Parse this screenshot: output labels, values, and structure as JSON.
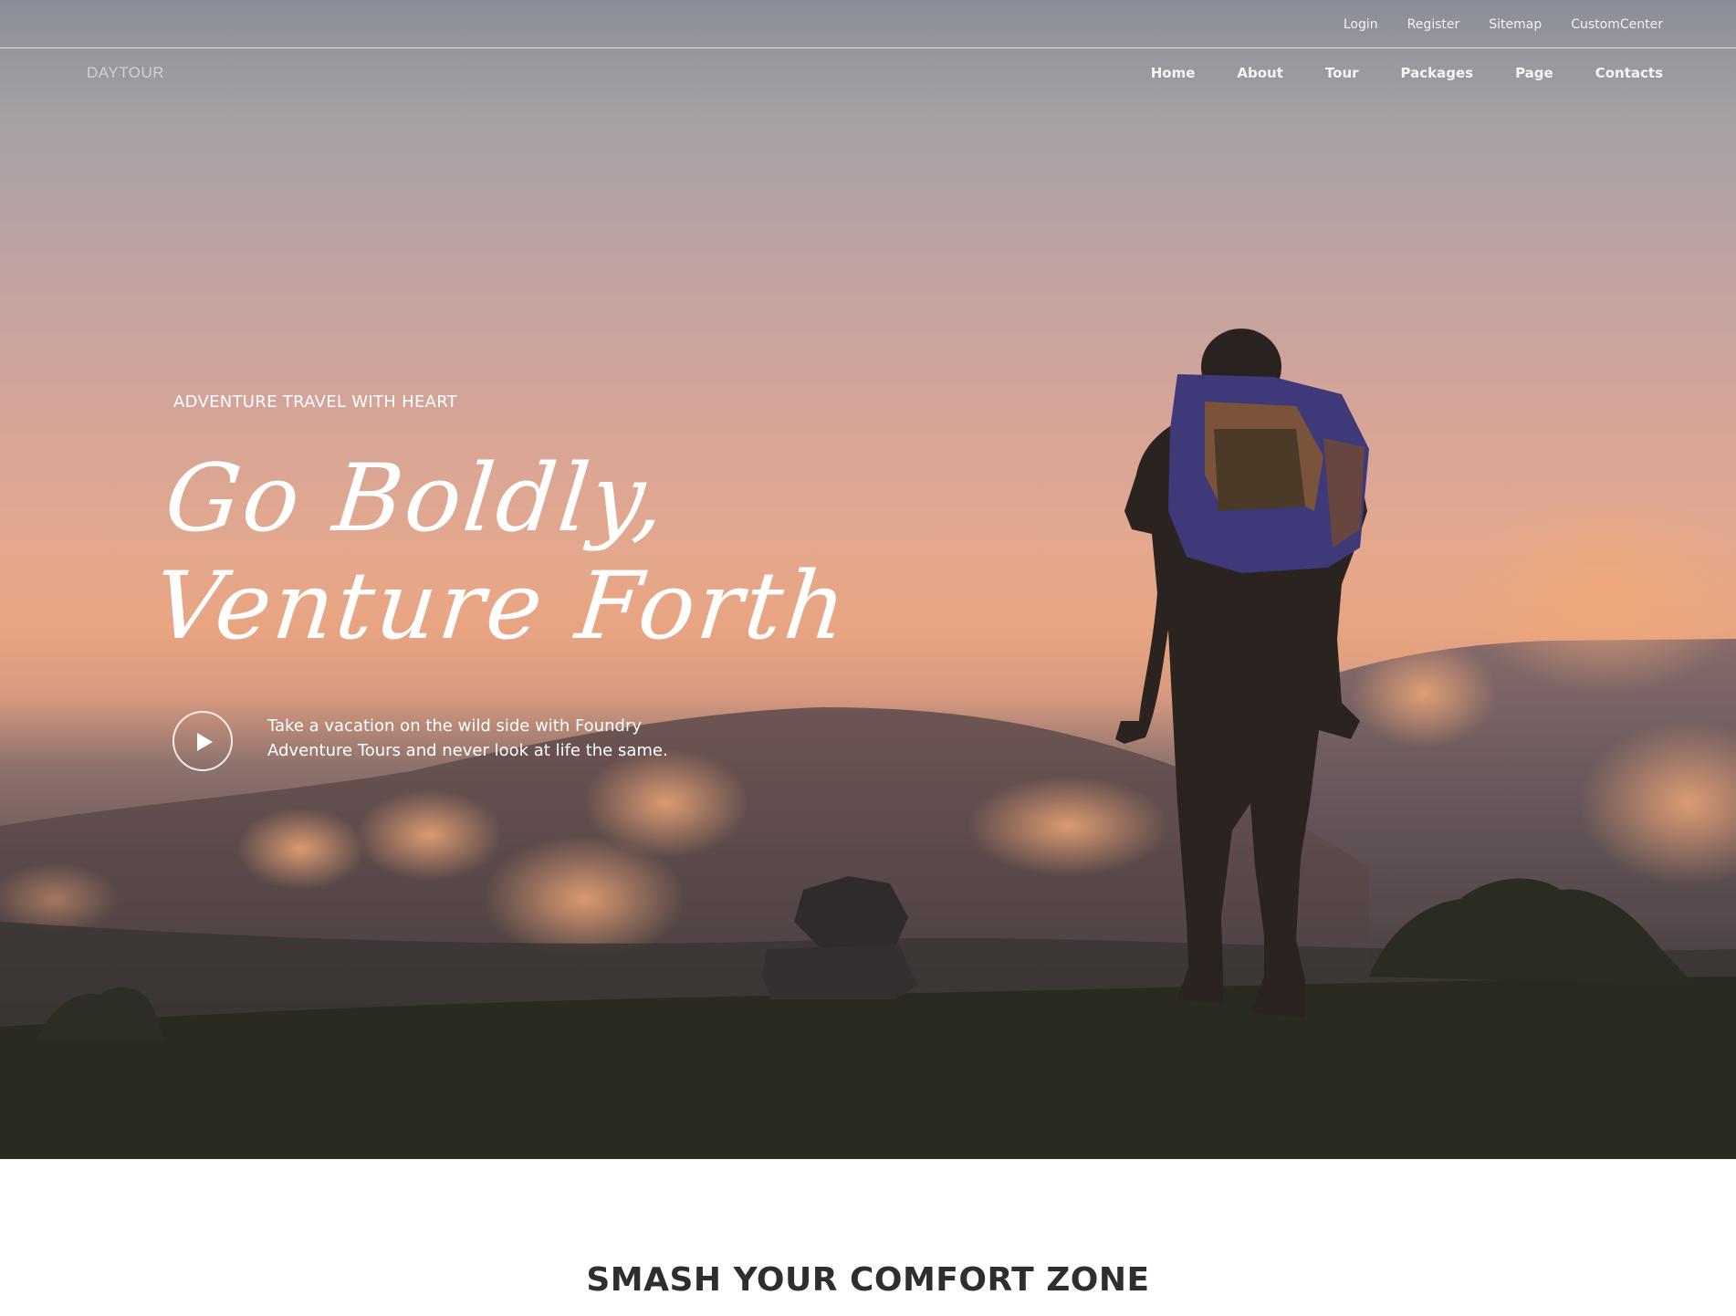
{
  "utility_nav": {
    "links": [
      "Login",
      "Register",
      "Sitemap",
      "CustomCenter"
    ]
  },
  "brand": {
    "logo": "DAYTOUR"
  },
  "main_nav": {
    "items": [
      "Home",
      "About",
      "Tour",
      "Packages",
      "Page",
      "Contacts"
    ]
  },
  "hero": {
    "eyebrow": "ADVENTURE TRAVEL WITH HEART",
    "headline_line1": "Go Boldly,",
    "headline_line2": "Venture Forth",
    "description": "Take a vacation on the wild side with Foundry Adventure Tours and never look at life the same.",
    "play_icon": "play-icon"
  },
  "section": {
    "title": "SMASH YOUR COMFORT ZONE"
  },
  "colors": {
    "sky_top": "#8a8e98",
    "sky_glow": "#e9a582",
    "ground": "#2c2c22",
    "title_text": "#2e2e2e"
  }
}
